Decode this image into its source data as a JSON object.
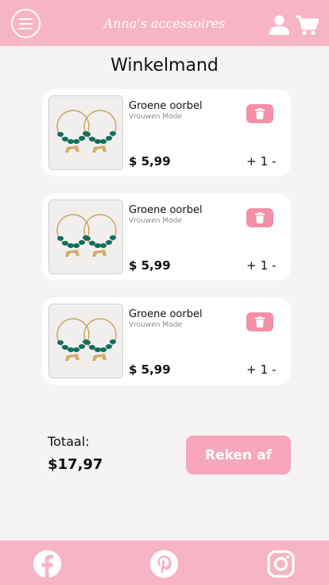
{
  "header": {
    "brand": "Anna's accessoires",
    "icons": [
      "menu-icon",
      "user-icon",
      "cart-icon"
    ]
  },
  "page": {
    "title": "Winkelmand"
  },
  "items": [
    {
      "name": "Groene oorbel",
      "category": "Vrouwen Mode",
      "price": "$ 5,99",
      "qty_plus": "+",
      "qty": "1",
      "qty_minus": "-"
    },
    {
      "name": "Groene oorbel",
      "category": "Vrouwen Mode",
      "price": "$ 5,99",
      "qty_plus": "+",
      "qty": "1",
      "qty_minus": "-"
    },
    {
      "name": "Groene oorbel",
      "category": "Vrouwen Mode",
      "price": "$ 5,99",
      "qty_plus": "+",
      "qty": "1",
      "qty_minus": "-"
    }
  ],
  "summary": {
    "total_label": "Totaal:",
    "total_value": "$17,97",
    "checkout_label": "Reken af"
  },
  "footer": {
    "icons": [
      "facebook-icon",
      "pinterest-icon",
      "instagram-icon"
    ]
  },
  "colors": {
    "brand_pink": "#f7b4c6",
    "delete_pink": "#f48ea9",
    "checkout_pink": "#f7a6bc",
    "background": "#f5f3f4",
    "earring_green": "#0f6e5c",
    "earring_gold": "#c9a55a"
  }
}
